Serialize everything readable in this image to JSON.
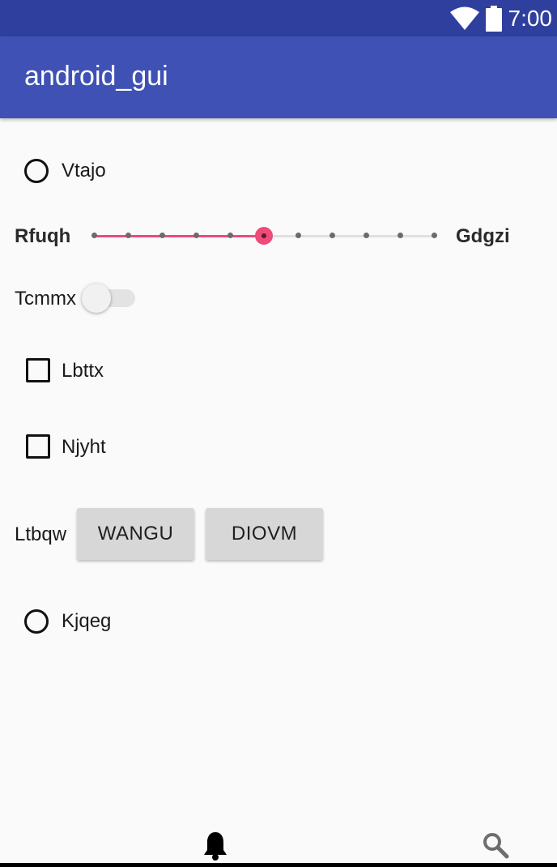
{
  "status_bar": {
    "time": "7:00",
    "icons": [
      "wifi-icon",
      "battery-icon"
    ]
  },
  "app_bar": {
    "title": "android_gui"
  },
  "radio_1": {
    "label": "Vtajo",
    "checked": false
  },
  "slider": {
    "start_label": "Rfuqh",
    "end_label": "Gdgzi",
    "value": 5,
    "max": 10,
    "accent": "#ef4a7a"
  },
  "switch": {
    "label": "Tcmmx",
    "on": false
  },
  "checkbox_1": {
    "label": "Lbttx",
    "checked": false
  },
  "checkbox_2": {
    "label": "Njyht",
    "checked": false
  },
  "button_row": {
    "label": "Ltbqw",
    "buttons": [
      "WANGU",
      "DIOVM"
    ]
  },
  "radio_2": {
    "label": "Kjqeg",
    "checked": false
  },
  "bottom_nav": {
    "icons": [
      "bell-icon",
      "search-icon"
    ]
  },
  "colors": {
    "primary": "#3f51b5",
    "primary_dark": "#2f3f9e",
    "accent": "#ef4a7a"
  }
}
